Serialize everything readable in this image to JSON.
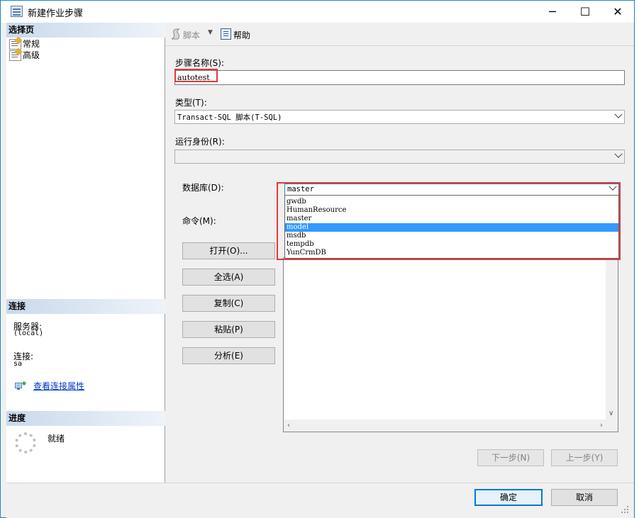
{
  "window": {
    "title": "新建作业步骤",
    "minimize_icon": "minimize-icon",
    "maximize_icon": "maximize-icon",
    "close_icon": "close-icon"
  },
  "left_pane": {
    "select_page_header": "选择页",
    "pages": [
      {
        "label": "常规",
        "icon": "page-wrench-icon"
      },
      {
        "label": "高级",
        "icon": "page-wrench-icon"
      }
    ],
    "connection_header": "连接",
    "server_label": "服务器:",
    "server_value": "(local)",
    "connection_label": "连接:",
    "connection_value": "sa",
    "view_connection_link": "查看连接属性",
    "progress_header": "进度",
    "status": "就绪"
  },
  "toolbar": {
    "script_label": "脚本",
    "help_label": "帮助"
  },
  "form": {
    "step_name_label": "步骤名称(S):",
    "step_name_value": "autotest",
    "type_label": "类型(T):",
    "type_value": "Transact-SQL 脚本(T-SQL)",
    "run_as_label": "运行身份(R):",
    "run_as_value": "",
    "database_label": "数据库(D):",
    "database_value": "master",
    "database_options": [
      "gwdb",
      "HumanResource",
      "master",
      "model",
      "msdb",
      "tempdb",
      "YunCrmDB"
    ],
    "database_highlighted": "model",
    "command_label": "命令(M):",
    "command_value": ""
  },
  "side_buttons": {
    "open": "打开(O)...",
    "select_all": "全选(A)",
    "copy": "复制(C)",
    "paste": "粘贴(P)",
    "parse": "分析(E)"
  },
  "nav_buttons": {
    "next": "下一步(N)",
    "previous": "上一步(Y)"
  },
  "dialog_buttons": {
    "ok": "确定",
    "cancel": "取消"
  },
  "colors": {
    "title_border": "#1883d7",
    "highlight": "#e03a3a",
    "selection": "#3399ff",
    "link": "#0033cc"
  }
}
